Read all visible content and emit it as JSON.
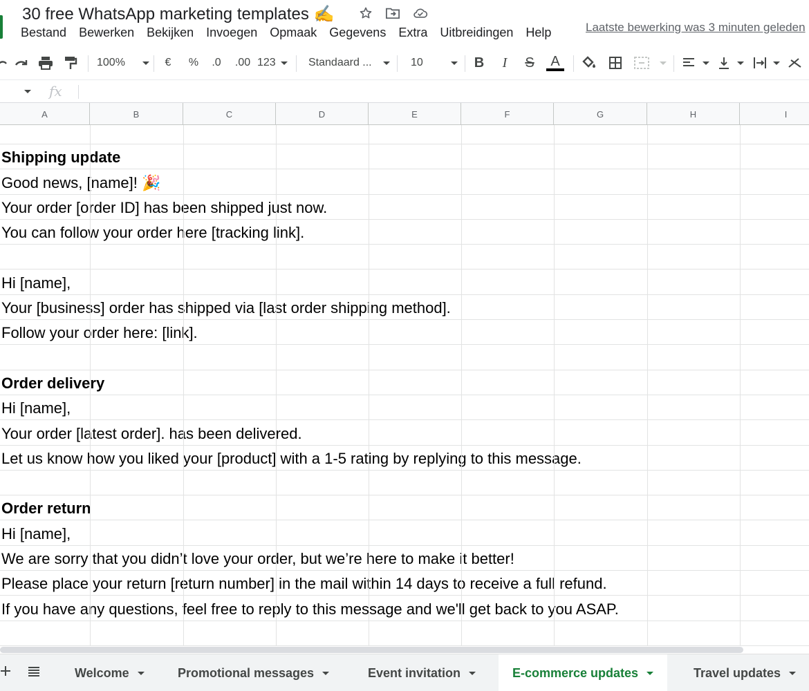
{
  "document": {
    "title": "30 free WhatsApp marketing templates ✍️",
    "last_edit": "Laatste bewerking was 3 minuten geleden"
  },
  "title_icons": [
    "star-icon",
    "move-to-folder-icon",
    "cloud-status-icon"
  ],
  "menu": [
    "Bestand",
    "Bewerken",
    "Bekijken",
    "Invoegen",
    "Opmaak",
    "Gegevens",
    "Extra",
    "Uitbreidingen",
    "Help"
  ],
  "toolbar": {
    "zoom": "100%",
    "currency": "€",
    "percent": "%",
    "decrease_decimals": ".0",
    "increase_decimals": ".00",
    "more_formats": "123",
    "font_family": "Standaard ...",
    "font_size": "10",
    "bold": "B",
    "italic": "I",
    "strikethrough": "S",
    "text_color": "A",
    "text_color_value": "#000000"
  },
  "formula_bar": {
    "fx": "fx",
    "value": ""
  },
  "columns": [
    "A",
    "B",
    "C",
    "D",
    "E",
    "F",
    "G",
    "H",
    "I"
  ],
  "rows": [
    {
      "text": "",
      "bold": false
    },
    {
      "text": "Shipping update",
      "bold": true
    },
    {
      "text": "Good news, [name]! 🎉",
      "bold": false
    },
    {
      "text": "Your order [order ID] has been shipped just now.",
      "bold": false
    },
    {
      "text": "You can follow your order here [tracking link].",
      "bold": false
    },
    {
      "text": "",
      "bold": false
    },
    {
      "text": "Hi [name],",
      "bold": false
    },
    {
      "text": "Your [business] order has shipped via [last order shipping method].",
      "bold": false
    },
    {
      "text": "Follow your order here: [link].",
      "bold": false
    },
    {
      "text": "",
      "bold": false
    },
    {
      "text": "Order delivery",
      "bold": true
    },
    {
      "text": "Hi [name],",
      "bold": false
    },
    {
      "text": "Your order [latest order]. has been delivered.",
      "bold": false
    },
    {
      "text": "Let us know how you liked your [product] with a 1-5 rating by replying to this message.",
      "bold": false
    },
    {
      "text": "",
      "bold": false
    },
    {
      "text": "Order return",
      "bold": true
    },
    {
      "text": "Hi [name],",
      "bold": false
    },
    {
      "text": "We are sorry that you didn’t love your order, but we’re here to make it better!",
      "bold": false
    },
    {
      "text": "Please place your return [return number] in the mail within 14 days to receive a full refund.",
      "bold": false
    },
    {
      "text": "If you have any questions, feel free to reply to this message and we'll get back to you ASAP.",
      "bold": false
    },
    {
      "text": "",
      "bold": false
    },
    {
      "text": "",
      "bold": false
    }
  ],
  "sheet_tabs": [
    {
      "label": "Welcome",
      "active": false
    },
    {
      "label": "Promotional messages",
      "active": false
    },
    {
      "label": "Event invitation",
      "active": false
    },
    {
      "label": "E-commerce updates",
      "active": true
    },
    {
      "label": "Travel updates",
      "active": false
    }
  ],
  "colors": {
    "accent": "#188038",
    "grid_line": "#e2e3e3",
    "header_bg": "#f8f9fa"
  }
}
